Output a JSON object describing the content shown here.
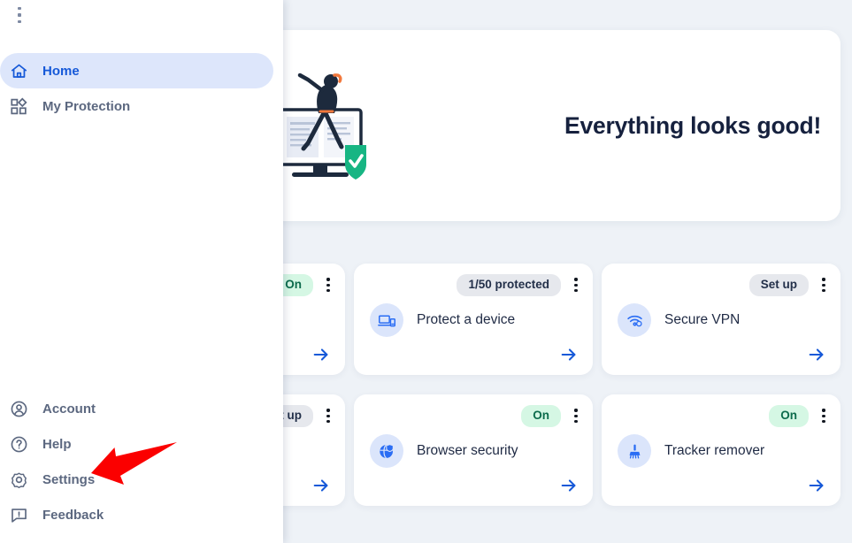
{
  "app": {
    "background_color": "#eef2f7",
    "accent_color": "#1659d8"
  },
  "hero": {
    "title": "Everything looks good!",
    "illustration_name": "person-on-monitor-with-shield-illustration",
    "shield_color": "#17b583"
  },
  "sidebar": {
    "kebab_name": "sidebar-overflow-menu",
    "top_items": [
      {
        "label": "Home",
        "icon": "home-icon",
        "active": true
      },
      {
        "label": "My Protection",
        "icon": "shapes-grid-icon",
        "active": false
      }
    ],
    "bottom_items": [
      {
        "label": "Account",
        "icon": "user-circle-icon",
        "active": false
      },
      {
        "label": "Help",
        "icon": "question-circle-icon",
        "active": false
      },
      {
        "label": "Settings",
        "icon": "gear-icon",
        "active": false
      },
      {
        "label": "Feedback",
        "icon": "feedback-chat-icon",
        "active": false
      }
    ]
  },
  "cards": [
    {
      "label": "",
      "badge": "On",
      "badge_type": "on",
      "icon": "generic-icon",
      "partially_hidden": true
    },
    {
      "label": "Protect a device",
      "badge": "1/50 protected",
      "badge_type": "neutral",
      "icon": "laptop-phone-icon",
      "partially_hidden": false
    },
    {
      "label": "Secure VPN",
      "badge": "Set up",
      "badge_type": "neutral",
      "icon": "vpn-wifi-icon",
      "partially_hidden": false
    },
    {
      "label": "",
      "badge": "Set up",
      "badge_type": "neutral",
      "icon": "generic-icon",
      "partially_hidden": true
    },
    {
      "label": "Browser security",
      "badge": "On",
      "badge_type": "on",
      "icon": "globe-shield-icon",
      "partially_hidden": false
    },
    {
      "label": "Tracker remover",
      "badge": "On",
      "badge_type": "on",
      "icon": "broom-icon",
      "partially_hidden": false
    }
  ],
  "annotation": {
    "arrow_name": "red-pointer-arrow",
    "color": "#fb0000",
    "points_at": "Settings"
  }
}
